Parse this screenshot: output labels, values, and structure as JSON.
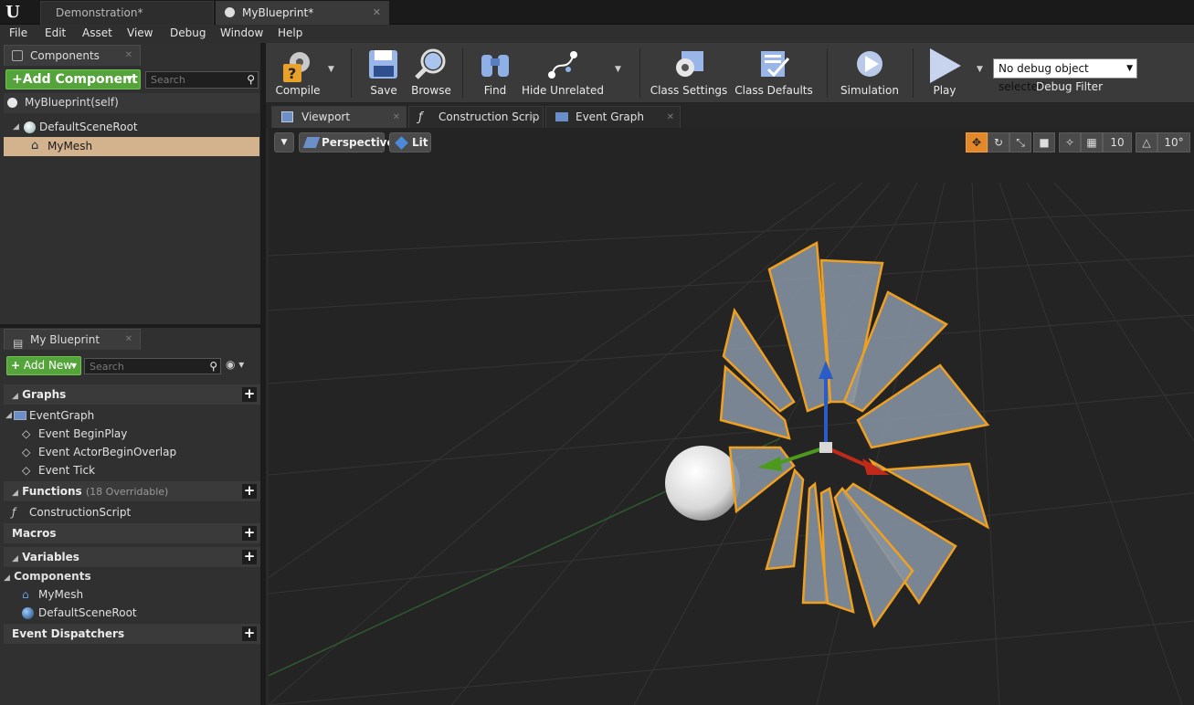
{
  "titlebar": {
    "tabs": [
      {
        "label": "Demonstration*"
      },
      {
        "label": "MyBlueprint*"
      }
    ]
  },
  "menu": [
    "File",
    "Edit",
    "Asset",
    "View",
    "Debug",
    "Window",
    "Help"
  ],
  "components_panel": {
    "tab_label": "Components",
    "add_button": "+Add Component",
    "search_placeholder": "Search",
    "self_item": "MyBlueprint(self)",
    "tree": [
      {
        "label": "DefaultSceneRoot"
      },
      {
        "label": "MyMesh",
        "selected": true
      }
    ]
  },
  "toolbar": {
    "compile": "Compile",
    "save": "Save",
    "browse": "Browse",
    "find": "Find",
    "hide_unrelated": "Hide Unrelated",
    "class_settings": "Class Settings",
    "class_defaults": "Class Defaults",
    "simulation": "Simulation",
    "play": "Play",
    "debug_select": "No debug object selected",
    "debug_filter": "Debug Filter"
  },
  "editor_tabs": [
    {
      "label": "Viewport",
      "active": true
    },
    {
      "label": "Construction Scrip"
    },
    {
      "label": "Event Graph"
    }
  ],
  "viewport": {
    "perspective": "Perspective",
    "lit": "Lit",
    "grid_snap": "10",
    "rotation_snap": "10°"
  },
  "my_blueprint": {
    "tab_label": "My Blueprint",
    "add_new": "Add New",
    "search_placeholder": "Search",
    "graphs": {
      "label": "Graphs",
      "event_graph": "EventGraph",
      "events": [
        "Event BeginPlay",
        "Event ActorBeginOverlap",
        "Event Tick"
      ]
    },
    "functions": {
      "label": "Functions",
      "overridable": "(18 Overridable)",
      "items": [
        "ConstructionScript"
      ]
    },
    "macros": "Macros",
    "variables": "Variables",
    "components": {
      "label": "Components",
      "items": [
        "MyMesh",
        "DefaultSceneRoot"
      ]
    },
    "event_dispatchers": "Event Dispatchers"
  },
  "colors": {
    "accent_green": "#55a33b",
    "selection": "#d3b28e",
    "outline_orange": "#f0a020"
  }
}
